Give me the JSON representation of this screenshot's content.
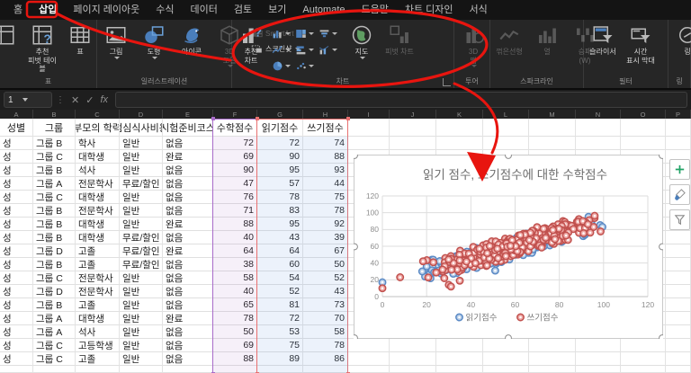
{
  "tabs": {
    "items": [
      {
        "id": "home",
        "label": "홈",
        "active": false
      },
      {
        "id": "insert",
        "label": "삽입",
        "active": true
      },
      {
        "id": "page-layout",
        "label": "페이지 레이아웃",
        "active": false
      },
      {
        "id": "formulas",
        "label": "수식",
        "active": false
      },
      {
        "id": "data",
        "label": "데이터",
        "active": false
      },
      {
        "id": "review",
        "label": "검토",
        "active": false
      },
      {
        "id": "view",
        "label": "보기",
        "active": false
      },
      {
        "id": "automate",
        "label": "Automate",
        "active": false
      },
      {
        "id": "help",
        "label": "도움말",
        "active": false
      },
      {
        "id": "chart-design",
        "label": "차트 디자인",
        "active": false
      },
      {
        "id": "format",
        "label": "서식",
        "active": false
      }
    ]
  },
  "ribbon": {
    "groups": [
      {
        "id": "table",
        "label": "표",
        "items": [
          {
            "type": "big",
            "label": "",
            "icon": "pivot-table-icon",
            "partial": true
          },
          {
            "type": "big",
            "label": "추천\n피벗 테이블",
            "icon": "recommended-pivot-icon"
          },
          {
            "type": "big",
            "label": "표",
            "icon": "table-icon"
          }
        ]
      },
      {
        "id": "illustrations",
        "label": "일러스트레이션",
        "items": [
          {
            "type": "big",
            "label": "그림",
            "icon": "picture-icon",
            "caret": true
          },
          {
            "type": "big",
            "label": "도형",
            "icon": "shapes-icon",
            "caret": true
          },
          {
            "type": "big",
            "label": "아이콘",
            "icon": "icons-icon"
          },
          {
            "type": "big",
            "label": "3D\n모델",
            "icon": "3d-model-icon",
            "disabled": true,
            "caret": true
          },
          {
            "type": "smallcol",
            "items": [
              {
                "label": "SmartArt",
                "icon": "smartart-icon",
                "disabled": true
              },
              {
                "label": "스크린샷",
                "icon": "screenshot-icon",
                "caret": true
              }
            ]
          }
        ]
      },
      {
        "id": "charts",
        "label": "차트",
        "launcher": true,
        "items": [
          {
            "type": "big",
            "label": "추천\n차트",
            "icon": "recommended-chart-icon"
          },
          {
            "type": "minigrid",
            "icons": [
              "column-chart-icon",
              "treemap-chart-icon",
              "funnel-chart-icon",
              "line-chart-icon",
              "bar-chart-icon",
              "combo-chart-icon",
              "pie-chart-icon",
              "scatter-chart-icon"
            ]
          },
          {
            "type": "big",
            "label": "지도",
            "icon": "map-icon",
            "caret": true
          },
          {
            "type": "big",
            "label": "피벗 차트",
            "icon": "pivot-chart-icon",
            "disabled": true
          }
        ]
      },
      {
        "id": "tours",
        "label": "투어",
        "items": [
          {
            "type": "big",
            "label": "3D\n맵",
            "icon": "3d-map-icon",
            "disabled": true,
            "caret": true
          }
        ]
      },
      {
        "id": "sparklines",
        "label": "스파크라인",
        "items": [
          {
            "type": "big",
            "label": "꺾은선형",
            "icon": "sparkline-line-icon",
            "disabled": true
          },
          {
            "type": "big",
            "label": "열",
            "icon": "sparkline-column-icon",
            "disabled": true
          },
          {
            "type": "big",
            "label": "승패\n(W)",
            "icon": "sparkline-winloss-icon",
            "disabled": true
          }
        ]
      },
      {
        "id": "filters",
        "label": "필터",
        "items": [
          {
            "type": "big",
            "label": "슬라이서",
            "icon": "slicer-icon"
          },
          {
            "type": "big",
            "label": "시간\n표시 막대",
            "icon": "timeline-icon"
          }
        ]
      },
      {
        "id": "links",
        "label": "링",
        "items": [
          {
            "type": "big",
            "label": "링",
            "icon": "link-icon"
          }
        ]
      }
    ]
  },
  "formula_bar": {
    "name_box": "1",
    "cancel": "✕",
    "enter": "✓",
    "fx": "fx",
    "input": ""
  },
  "sheet": {
    "column_letters": [
      "A",
      "B",
      "C",
      "D",
      "E",
      "F",
      "G",
      "H",
      "I",
      "J",
      "K",
      "L",
      "M",
      "N",
      "O",
      "P"
    ],
    "header_row": [
      "성별",
      "그룹",
      "부모의 학력",
      "점심식사비용",
      "시험준비코스",
      "수학점수",
      "읽기점수",
      "쓰기점수"
    ],
    "rows": [
      [
        "성",
        "그룹 B",
        "학사",
        "일반",
        "없음",
        72,
        72,
        74
      ],
      [
        "성",
        "그룹 C",
        "대학생",
        "일반",
        "완료",
        69,
        90,
        88
      ],
      [
        "성",
        "그룹 B",
        "석사",
        "일반",
        "없음",
        90,
        95,
        93
      ],
      [
        "성",
        "그룹 A",
        "전문학사",
        "무료/할인",
        "없음",
        47,
        57,
        44
      ],
      [
        "성",
        "그룹 C",
        "대학생",
        "일반",
        "없음",
        76,
        78,
        75
      ],
      [
        "성",
        "그룹 B",
        "전문학사",
        "일반",
        "없음",
        71,
        83,
        78
      ],
      [
        "성",
        "그룹 B",
        "대학생",
        "일반",
        "완료",
        88,
        95,
        92
      ],
      [
        "성",
        "그룹 B",
        "대학생",
        "무료/할인",
        "없음",
        40,
        43,
        39
      ],
      [
        "성",
        "그룹 D",
        "고졸",
        "무료/할인",
        "완료",
        64,
        64,
        67
      ],
      [
        "성",
        "그룹 B",
        "고졸",
        "무료/할인",
        "없음",
        38,
        60,
        50
      ],
      [
        "성",
        "그룹 C",
        "전문학사",
        "일반",
        "없음",
        58,
        54,
        52
      ],
      [
        "성",
        "그룹 D",
        "전문학사",
        "일반",
        "없음",
        40,
        52,
        43
      ],
      [
        "성",
        "그룹 B",
        "고졸",
        "일반",
        "없음",
        65,
        81,
        73
      ],
      [
        "성",
        "그룹 A",
        "대학생",
        "일반",
        "완료",
        78,
        72,
        70
      ],
      [
        "성",
        "그룹 A",
        "석사",
        "일반",
        "없음",
        50,
        53,
        58
      ],
      [
        "성",
        "그룹 C",
        "고등학생",
        "일반",
        "없음",
        69,
        75,
        78
      ],
      [
        "성",
        "그룹 C",
        "고졸",
        "일반",
        "없음",
        88,
        89,
        86
      ]
    ],
    "highlights": {
      "math_range": {
        "columns": "F",
        "border": "#a86bc9",
        "fill": "rgba(168,107,201,0.10)"
      },
      "score_range": {
        "columns": "G:H",
        "border": "#e87070",
        "fill": "rgba(120,160,230,0.14)"
      }
    }
  },
  "chart_data": {
    "type": "scatter",
    "title": "읽기 점수, 쓰기점수에 대한 수학점수",
    "xlim": [
      0,
      120
    ],
    "ylim": [
      0,
      120
    ],
    "x_ticks": [
      0,
      20,
      40,
      60,
      80,
      100,
      120
    ],
    "y_ticks": [
      0,
      20,
      40,
      60,
      80,
      100,
      120
    ],
    "grid": true,
    "legend_position": "bottom",
    "colors": {
      "title": "#6e6e6e",
      "axis_text": "#8e8e8e",
      "gridline": "#dedede",
      "chart_border": "#c9c9c9"
    },
    "series": [
      {
        "name": "읽기점수",
        "marker_stroke": "#5b8ac5",
        "marker_fill": "#b9cfe9",
        "cloud": {
          "count": 270,
          "seed": 11,
          "x_min": 16,
          "x_max": 102,
          "slope": 0.74,
          "intercept": 15,
          "spread": 15,
          "y_min": 13,
          "y_max": 103
        },
        "outliers": [
          [
            0,
            17
          ],
          [
            18,
            30
          ],
          [
            20,
            36
          ],
          [
            23,
            44
          ],
          [
            51,
            31
          ]
        ]
      },
      {
        "name": "쓰기점수",
        "marker_stroke": "#c1514e",
        "marker_fill": "#efa9a6",
        "cloud": {
          "count": 350,
          "seed": 7,
          "x_min": 17,
          "x_max": 101,
          "slope": 0.75,
          "intercept": 16,
          "spread": 15,
          "y_min": 11,
          "y_max": 103
        },
        "outliers": [
          [
            0,
            10
          ],
          [
            8,
            23
          ],
          [
            28,
            22
          ],
          [
            30,
            14
          ],
          [
            31,
            12
          ],
          [
            35,
            19
          ]
        ]
      }
    ]
  },
  "chart_ui": {
    "buttons": [
      {
        "icon": "plus-icon"
      },
      {
        "icon": "brush-icon"
      },
      {
        "icon": "funnel-icon"
      }
    ]
  },
  "annotations": {
    "color": "#e8150f"
  }
}
